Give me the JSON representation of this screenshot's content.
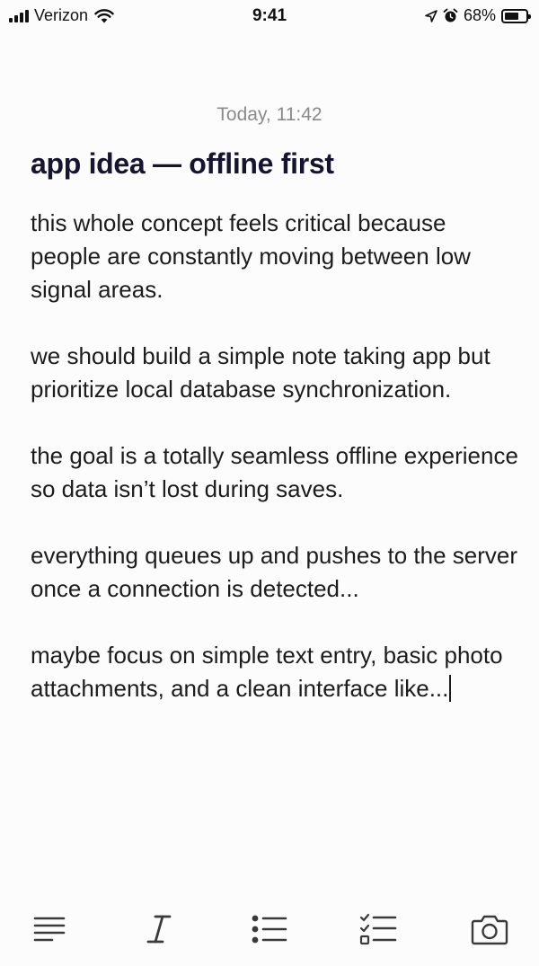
{
  "status_bar": {
    "carrier": "Verizon",
    "time": "9:41",
    "battery_percent": "68%",
    "battery_level": 0.68,
    "icons": [
      "signal-icon",
      "wifi-icon",
      "location-icon",
      "alarm-icon",
      "battery-icon"
    ]
  },
  "note": {
    "date": "Today, 11:42",
    "title": "app idea — offline first",
    "paragraphs": [
      "this whole concept feels critical because people are constantly moving between low signal areas.",
      "we should build a simple note taking app but prioritize local database synchronization.",
      "the goal is a totally seamless offline experience so data isn’t lost during saves.",
      "everything queues up and pushes to the server once a connection is detected...",
      "maybe focus on simple text entry, basic photo attachments, and a clean interface like..."
    ]
  },
  "toolbar": {
    "items": [
      "align-text-icon",
      "italic-icon",
      "bulleted-list-icon",
      "checklist-icon",
      "camera-icon"
    ]
  }
}
